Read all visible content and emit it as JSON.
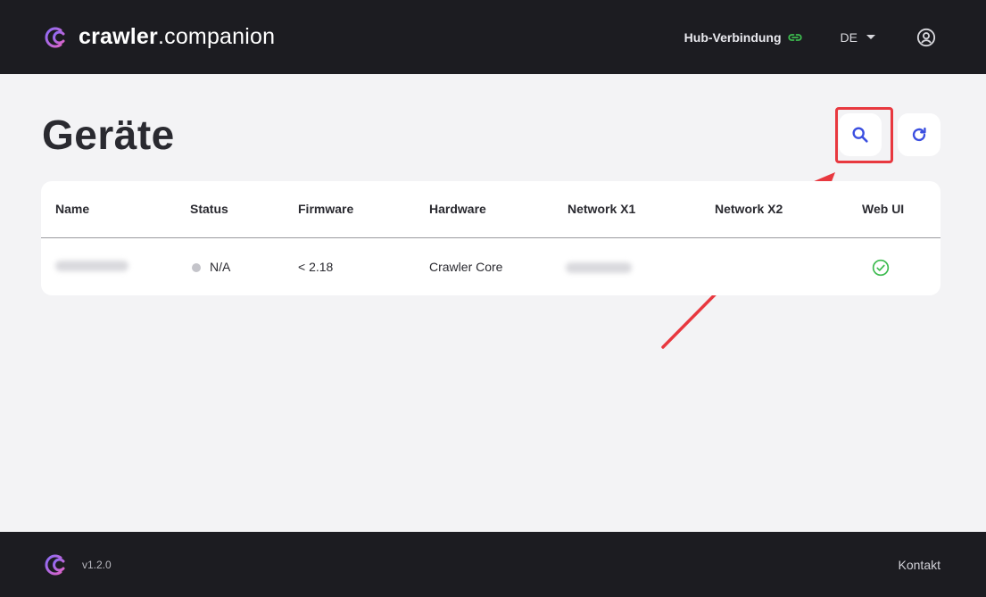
{
  "header": {
    "brand_bold": "crawler",
    "brand_rest": ".companion",
    "hub_label": "Hub-Verbindung",
    "language": "DE"
  },
  "main": {
    "title": "Geräte",
    "table": {
      "columns": [
        "Name",
        "Status",
        "Firmware",
        "Hardware",
        "Network X1",
        "Network X2",
        "Web UI"
      ],
      "rows": [
        {
          "name": "",
          "status": "N/A",
          "firmware": "< 2.18",
          "hardware": "Crawler Core",
          "network_x1": "",
          "network_x2": ""
        }
      ]
    }
  },
  "footer": {
    "version": "v1.2.0",
    "contact": "Kontakt"
  },
  "colors": {
    "header_bg": "#1c1c21",
    "page_bg": "#f3f3f5",
    "accent": "#3b4fe0",
    "link_green": "#3dbb4f",
    "highlight_red": "#e8383f"
  }
}
